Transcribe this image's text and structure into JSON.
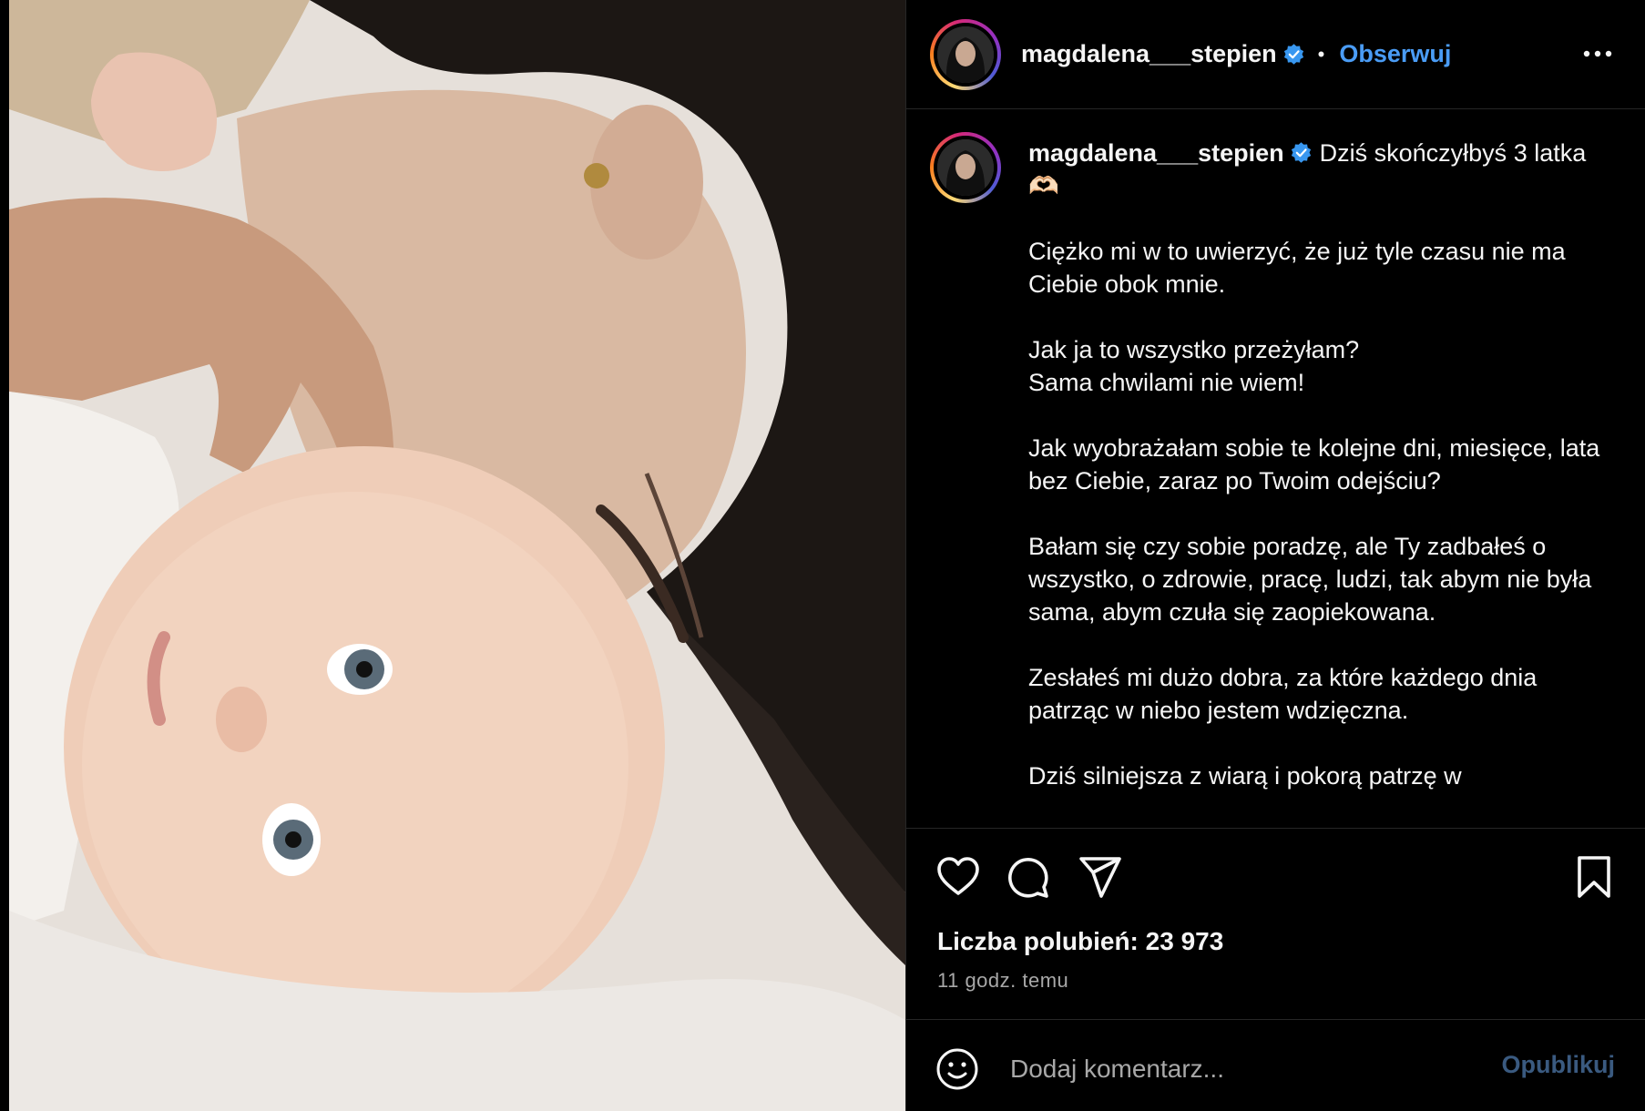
{
  "post": {
    "username": "magdalena___stepien",
    "follow_label": "Obserwuj",
    "separator": "•"
  },
  "caption": {
    "username": "magdalena___stepien",
    "first_line": "Dziś skończyłbyś 3 latka 🫶🏻",
    "paragraphs": [
      "Ciężko mi w to uwierzyć, że już tyle czasu nie ma Ciebie obok mnie.",
      "Jak ja to wszystko przeżyłam?\nSama chwilami nie wiem!",
      "Jak wyobrażałam sobie te kolejne dni, miesięce, lata bez Ciebie, zaraz po Twoim odejściu?",
      "Bałam się czy sobie poradzę, ale Ty zadbałeś o wszystko, o zdrowie, pracę, ludzi, tak abym nie była sama, abym czuła się zaopiekowana.",
      "Zesłałeś mi dużo dobra, za które każdego dnia patrząc w niebo jestem wdzięczna.",
      "Dziś silniejsza z wiarą i pokorą patrzę w"
    ]
  },
  "stats": {
    "likes": "Liczba polubień: 23 973",
    "time_ago": "11 godz. temu"
  },
  "comment": {
    "placeholder": "Dodaj komentarz...",
    "publish_label": "Opublikuj"
  },
  "colors": {
    "background": "#000000",
    "link_blue": "#4a9cf5",
    "verified_blue": "#3897f0",
    "muted_text": "#a8a8a8",
    "publish_disabled": "#3a5a80"
  },
  "icons": {
    "header": [
      "avatar",
      "verified-badge-icon",
      "more-options-icon"
    ],
    "actions": [
      "heart-icon",
      "comment-icon",
      "share-icon",
      "bookmark-icon"
    ],
    "comment": [
      "emoji-icon"
    ]
  }
}
